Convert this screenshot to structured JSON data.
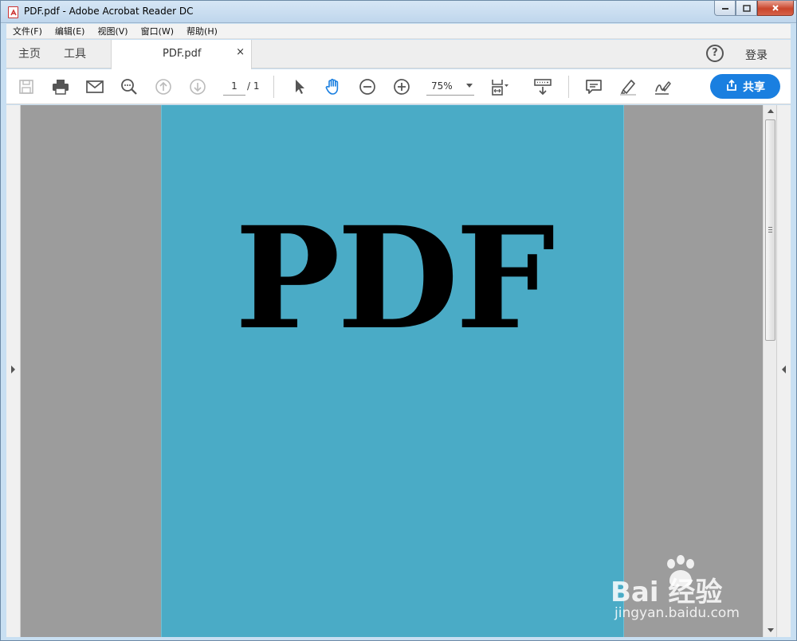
{
  "window": {
    "title": "PDF.pdf - Adobe Acrobat Reader DC"
  },
  "menu": {
    "items": [
      "文件(F)",
      "编辑(E)",
      "视图(V)",
      "窗口(W)",
      "帮助(H)"
    ]
  },
  "tabs": {
    "home": "主页",
    "tools": "工具",
    "document": "PDF.pdf",
    "close_glyph": "×",
    "help_glyph": "?",
    "login": "登录"
  },
  "toolbar": {
    "page_current": "1",
    "page_total": "/ 1",
    "zoom": "75%",
    "share_label": "共享"
  },
  "document": {
    "text": "PDF",
    "background_color": "#4aabc6"
  },
  "watermark": {
    "brand": "Bai  经验",
    "url": "jingyan.baidu.com"
  },
  "colors": {
    "accent": "#1a7fe0",
    "viewer_bg": "#9c9c9c"
  }
}
